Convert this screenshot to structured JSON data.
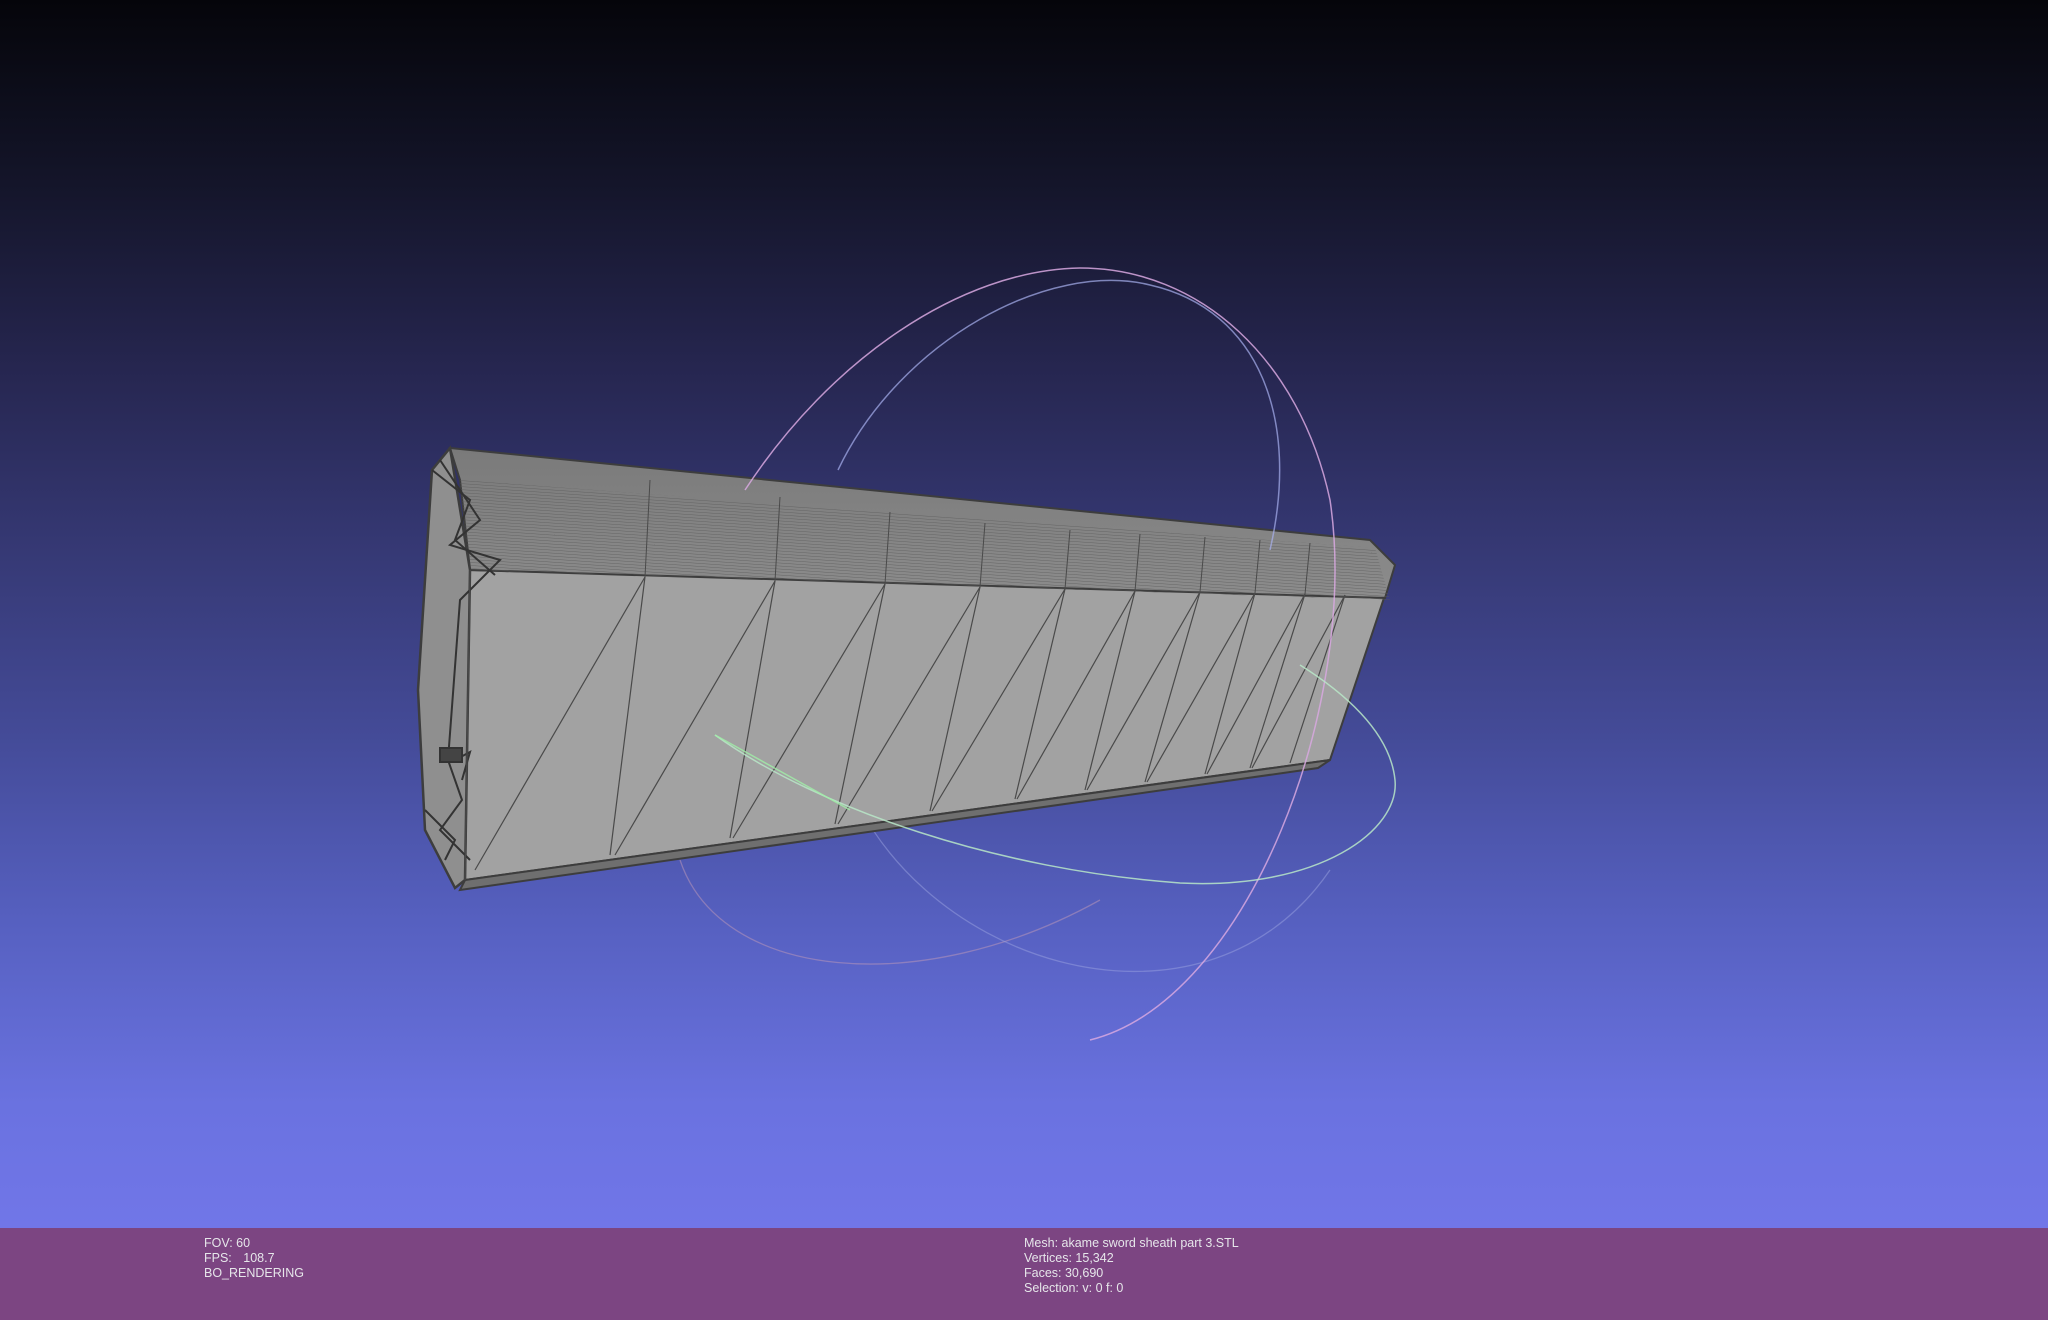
{
  "viewer": {
    "background_top": "#05050a",
    "background_bottom": "#7176e8",
    "mesh_fill": "#9b9b9b",
    "mesh_edge": "#3d3d3d",
    "trackball": {
      "x_color": "#ff8fb0",
      "y_color": "#a0ffb0",
      "z_color": "#b0b8ff"
    }
  },
  "status": {
    "fov": "FOV: 60",
    "fps_label": "FPS:",
    "fps_value": "108.7",
    "mode": "BO_RENDERING",
    "mesh": "Mesh: akame sword sheath part 3.STL",
    "vertices": "Vertices: 15,342",
    "faces": "Faces: 30,690",
    "selection": "Selection: v: 0 f: 0"
  }
}
